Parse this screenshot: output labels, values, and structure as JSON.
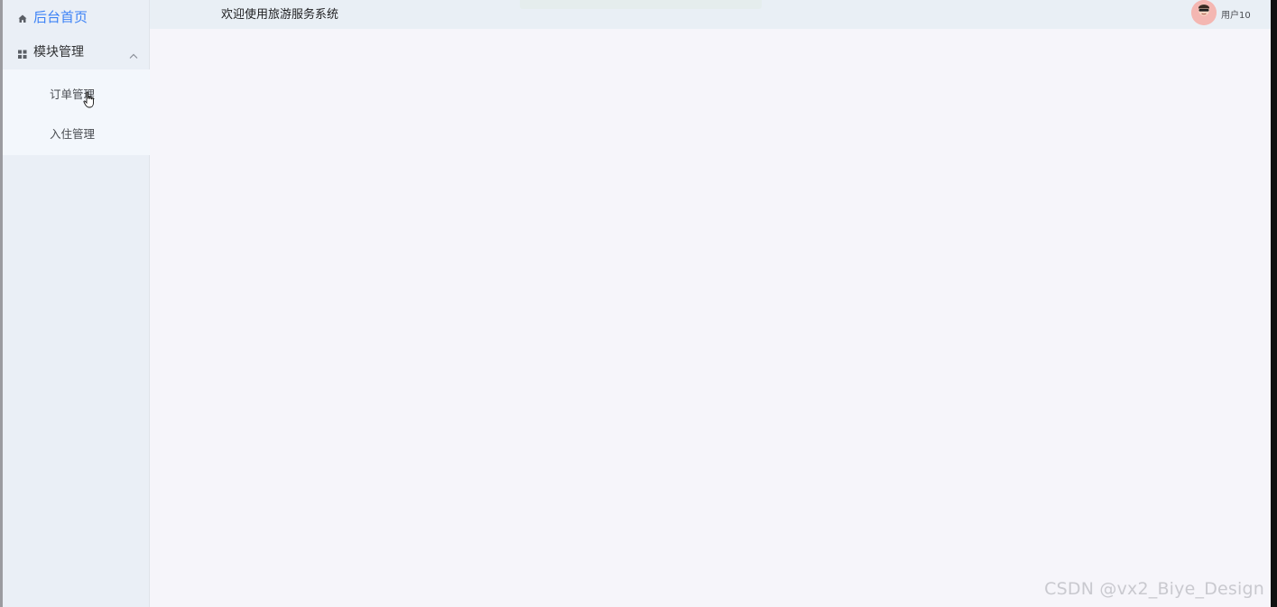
{
  "sidebar": {
    "home_label": "后台首页",
    "module_label": "模块管理",
    "submenu": [
      {
        "label": "订单管理"
      },
      {
        "label": "入住管理"
      }
    ]
  },
  "header": {
    "welcome": "欢迎使用旅游服务系统",
    "username": "用户10"
  },
  "watermark": "CSDN @vx2_Biye_Design",
  "colors": {
    "accent": "#3c82f6",
    "sidebar_bg": "#eaeff6",
    "content_bg": "#f6f5fa"
  },
  "icons": {
    "home": "home-icon",
    "modules": "grid-icon",
    "expand": "chevron-up-icon",
    "avatar": "avatar-icon"
  }
}
